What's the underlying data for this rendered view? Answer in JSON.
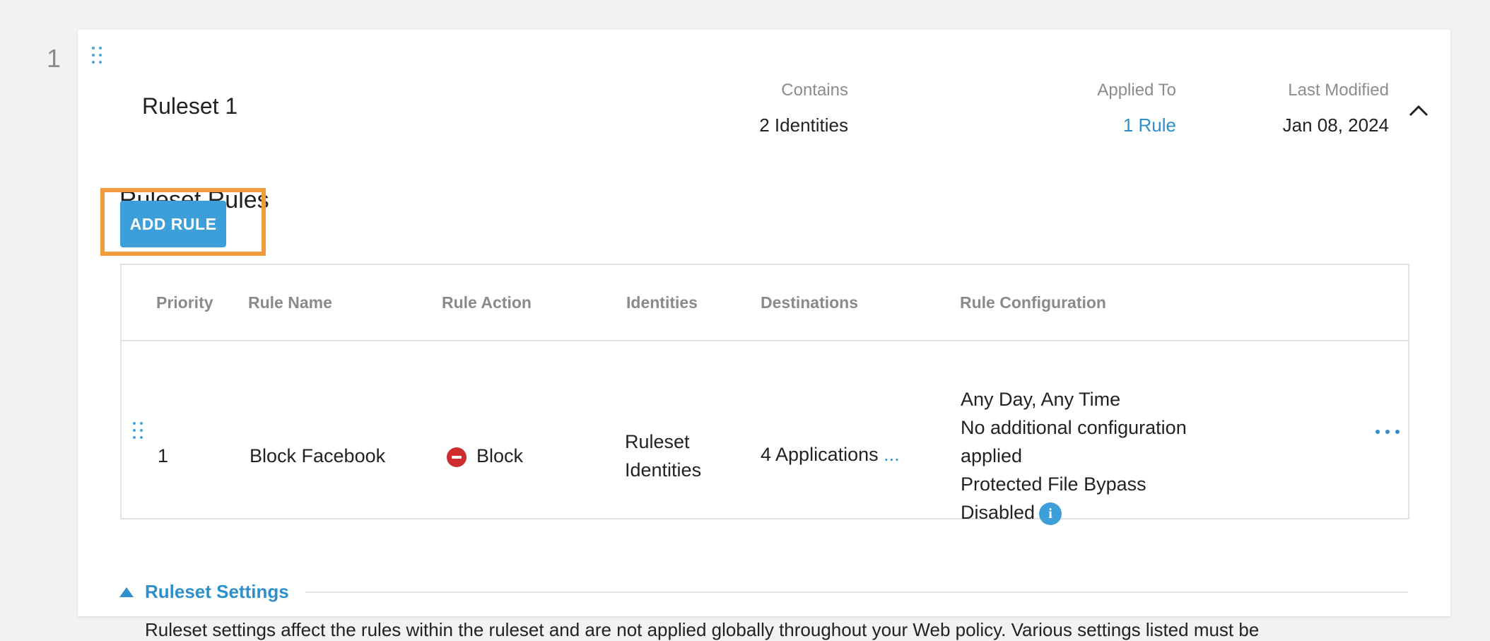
{
  "ruleset_index": "1",
  "ruleset": {
    "title": "Ruleset 1",
    "contains_label": "Contains",
    "contains_value": "2 Identities",
    "applied_to_label": "Applied To",
    "applied_to_value": "1 Rule",
    "last_modified_label": "Last Modified",
    "last_modified_value": "Jan 08, 2024",
    "collapse_icon": "chevron-up-icon"
  },
  "rules_section": {
    "heading": "Ruleset Rules",
    "add_rule_label": "ADD RULE"
  },
  "table": {
    "headers": {
      "priority": "Priority",
      "rule_name": "Rule Name",
      "rule_action": "Rule Action",
      "identities": "Identities",
      "destinations": "Destinations",
      "rule_configuration": "Rule Configuration"
    },
    "rows": [
      {
        "priority": "1",
        "rule_name": "Block Facebook",
        "rule_action": "Block",
        "identities_line1": "Ruleset",
        "identities_line2": "Identities",
        "destinations": "4 Applications",
        "destinations_more": "...",
        "config_line1": "Any Day, Any Time",
        "config_line2": "No additional configuration",
        "config_line3": "applied",
        "config_line4": "Protected File Bypass",
        "config_line5": "Disabled"
      }
    ]
  },
  "settings": {
    "toggle_label": "Ruleset Settings",
    "description": "Ruleset settings affect the rules within the ruleset and are not applied globally throughout your Web policy. Various settings listed must be"
  },
  "colors": {
    "accent": "#3d9fd9",
    "link": "#2d8fcb",
    "highlight": "#f19a3e",
    "block": "#cf2d2d"
  }
}
